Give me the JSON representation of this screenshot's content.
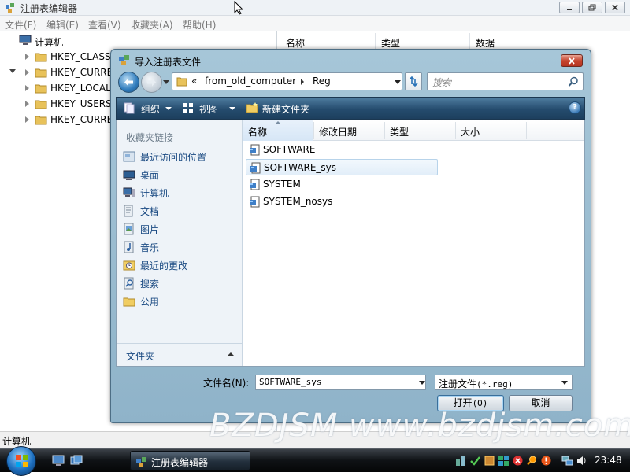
{
  "regedit": {
    "title": "注册表编辑器",
    "menu": [
      "文件(F)",
      "编辑(E)",
      "查看(V)",
      "收藏夹(A)",
      "帮助(H)"
    ],
    "tree": {
      "root": "计算机",
      "children": [
        "HKEY_CLASSE",
        "HKEY_CURRE",
        "HKEY_LOCAL_",
        "HKEY_USERS",
        "HKEY_CURRE"
      ]
    },
    "columns": [
      "名称",
      "类型",
      "数据"
    ],
    "status": "计算机"
  },
  "dialog": {
    "title": "导入注册表文件",
    "address": {
      "prefix": "«",
      "segments": [
        "from_old_computer",
        "Reg"
      ]
    },
    "search_placeholder": "搜索",
    "toolbar": {
      "organize": "组织",
      "views": "视图",
      "new_folder": "新建文件夹",
      "help": "?"
    },
    "favorites": {
      "header": "收藏夹链接",
      "links": [
        "最近访问的位置",
        "桌面",
        "计算机",
        "文档",
        "图片",
        "音乐",
        "最近的更改",
        "搜索",
        "公用"
      ],
      "folders_label": "文件夹"
    },
    "columns": [
      "名称",
      "修改日期",
      "类型",
      "大小"
    ],
    "files": [
      "SOFTWARE",
      "SOFTWARE_sys",
      "SYSTEM",
      "SYSTEM_nosys"
    ],
    "selected_file_index": 1,
    "filename_label": "文件名(N):",
    "filename_value": "SOFTWARE_sys",
    "filetype_label": "注册文件",
    "filetype_ext": "(*.reg)",
    "open_button": "打开",
    "open_button_key": "(O)",
    "cancel_button": "取消"
  },
  "watermark": "BZDJSM www.bzdjsm.com",
  "taskbar": {
    "task_label": "注册表编辑器",
    "clock": "23:48"
  },
  "colors": {
    "command_bar": "#254c6e",
    "link_text": "#1a4a82",
    "selection_bg": "#e2eef9",
    "close_button": "#c6452f"
  }
}
